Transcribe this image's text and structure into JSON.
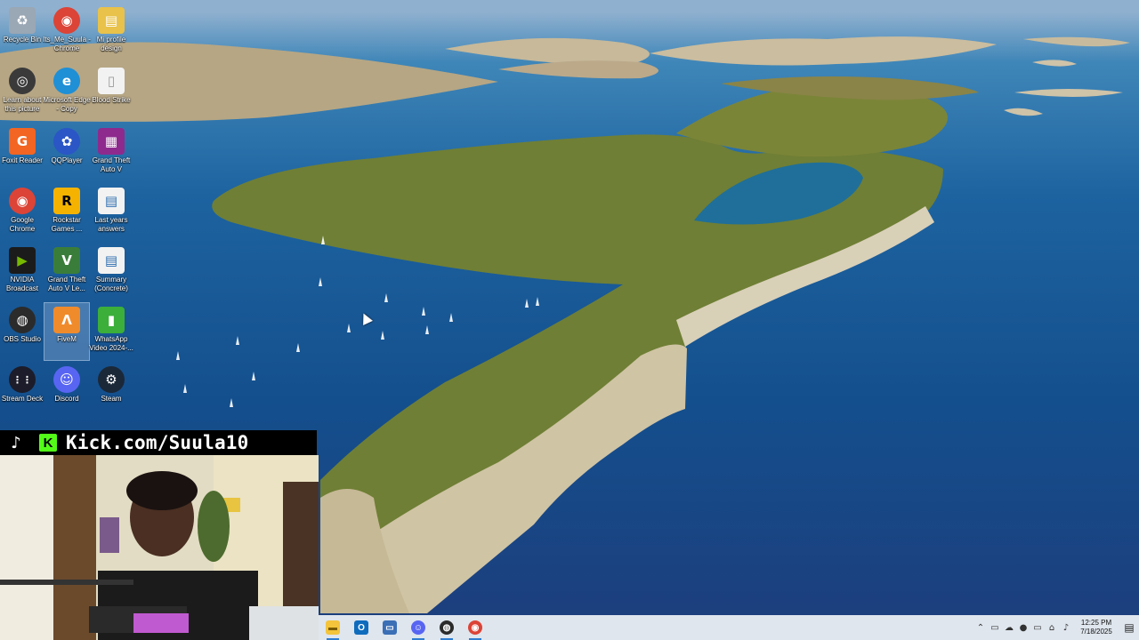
{
  "desktop": {
    "icons": [
      {
        "label": "Recycle Bin",
        "icon": "recycle-bin-icon",
        "color": "#9aa7b4",
        "glyph": "♻"
      },
      {
        "label": "Its_Me_Suula - Chrome",
        "icon": "chrome-icon",
        "color": "#db4437",
        "glyph": "◉"
      },
      {
        "label": "Mi profile design",
        "icon": "image-file-icon",
        "color": "#e8c24a",
        "glyph": "▤"
      },
      {
        "label": "Learn about this picture",
        "icon": "camera-icon",
        "color": "#3a3a3a",
        "glyph": "◎"
      },
      {
        "label": "Microsoft Edge - Copy",
        "icon": "edge-icon",
        "color": "#1f8fd6",
        "glyph": "e"
      },
      {
        "label": "Blood Strike",
        "icon": "file-icon",
        "color": "#f2f2f2",
        "glyph": "▯"
      },
      {
        "label": "Foxit Reader",
        "icon": "foxit-icon",
        "color": "#f26522",
        "glyph": "G"
      },
      {
        "label": "QQPlayer",
        "icon": "qqplayer-icon",
        "color": "#2a56c6",
        "glyph": "✿"
      },
      {
        "label": "Grand Theft Auto V",
        "icon": "winrar-icon",
        "color": "#8e2a8e",
        "glyph": "▦"
      },
      {
        "label": "Google Chrome",
        "icon": "chrome-icon",
        "color": "#db4437",
        "glyph": "◉"
      },
      {
        "label": "Rockstar Games ...",
        "icon": "rockstar-icon",
        "color": "#f5b300",
        "glyph": "R"
      },
      {
        "label": "Last years answers",
        "icon": "document-icon",
        "color": "#f2f2f2",
        "glyph": "▤"
      },
      {
        "label": "NVIDIA Broadcast",
        "icon": "nvidia-icon",
        "color": "#1b1b1b",
        "glyph": "▶"
      },
      {
        "label": "Grand Theft Auto V Le...",
        "icon": "gta-icon",
        "color": "#3a7d3a",
        "glyph": "V"
      },
      {
        "label": "Summary (Concrete)",
        "icon": "document-icon",
        "color": "#f2f2f2",
        "glyph": "▤"
      },
      {
        "label": "OBS Studio",
        "icon": "obs-icon",
        "color": "#2b2b2b",
        "glyph": "◍"
      },
      {
        "label": "FiveM",
        "icon": "fivem-icon",
        "color": "#f08b2c",
        "glyph": "Λ"
      },
      {
        "label": "WhatsApp Video 2024-...",
        "icon": "video-file-icon",
        "color": "#3cae3a",
        "glyph": "▮"
      },
      {
        "label": "Stream Deck",
        "icon": "stream-deck-icon",
        "color": "#1c1c2a",
        "glyph": "⋮⋮"
      },
      {
        "label": "Discord",
        "icon": "discord-icon",
        "color": "#5865f2",
        "glyph": "☺"
      },
      {
        "label": "Steam",
        "icon": "steam-icon",
        "color": "#1b2838",
        "glyph": "⚙"
      }
    ]
  },
  "overlay": {
    "kick_url": "Kick.com/Suula10",
    "kick_letter": "K",
    "kick_color": "#53fc18"
  },
  "taskbar": {
    "apps": [
      {
        "name": "file-explorer",
        "icon": "folder-icon",
        "color": "#f3c43c",
        "glyph": "▬"
      },
      {
        "name": "outlook",
        "icon": "outlook-icon",
        "color": "#0f6cbd",
        "glyph": "O"
      },
      {
        "name": "remote-desktop",
        "icon": "monitor-icon",
        "color": "#3b6fb6",
        "glyph": "▭"
      },
      {
        "name": "discord",
        "icon": "discord-icon",
        "color": "#5865f2",
        "glyph": "☺"
      },
      {
        "name": "obs",
        "icon": "obs-icon",
        "color": "#2b2b2b",
        "glyph": "◍"
      },
      {
        "name": "chrome",
        "icon": "chrome-icon",
        "color": "#db4437",
        "glyph": "◉"
      }
    ],
    "tray": {
      "time": "12:25 PM",
      "date": "7/18/2025"
    }
  }
}
